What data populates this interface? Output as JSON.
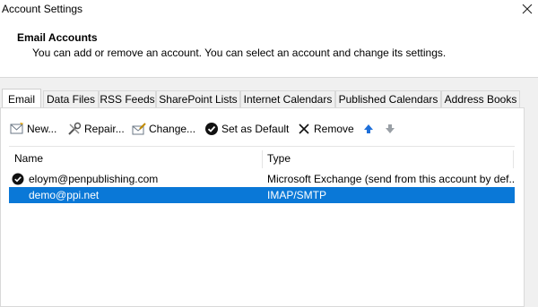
{
  "window": {
    "title": "Account Settings"
  },
  "header": {
    "title": "Email Accounts",
    "subtitle": "You can add or remove an account. You can select an account and change its settings."
  },
  "tabs": [
    {
      "label": "Email",
      "active": true
    },
    {
      "label": "Data Files"
    },
    {
      "label": "RSS Feeds"
    },
    {
      "label": "SharePoint Lists"
    },
    {
      "label": "Internet Calendars"
    },
    {
      "label": "Published Calendars"
    },
    {
      "label": "Address Books"
    }
  ],
  "toolbar": {
    "new_label": "New...",
    "repair_label": "Repair...",
    "change_label": "Change...",
    "set_default_label": "Set as Default",
    "remove_label": "Remove"
  },
  "list": {
    "columns": {
      "name": "Name",
      "type": "Type"
    },
    "rows": [
      {
        "name": "eloym@penpublishing.com",
        "type": "Microsoft Exchange (send from this account by def...",
        "default": true,
        "selected": false
      },
      {
        "name": "demo@ppi.net",
        "type": "IMAP/SMTP",
        "default": false,
        "selected": true
      }
    ]
  },
  "colors": {
    "selection": "#0a78d7",
    "accent_arrow": "#1e6fd9"
  }
}
